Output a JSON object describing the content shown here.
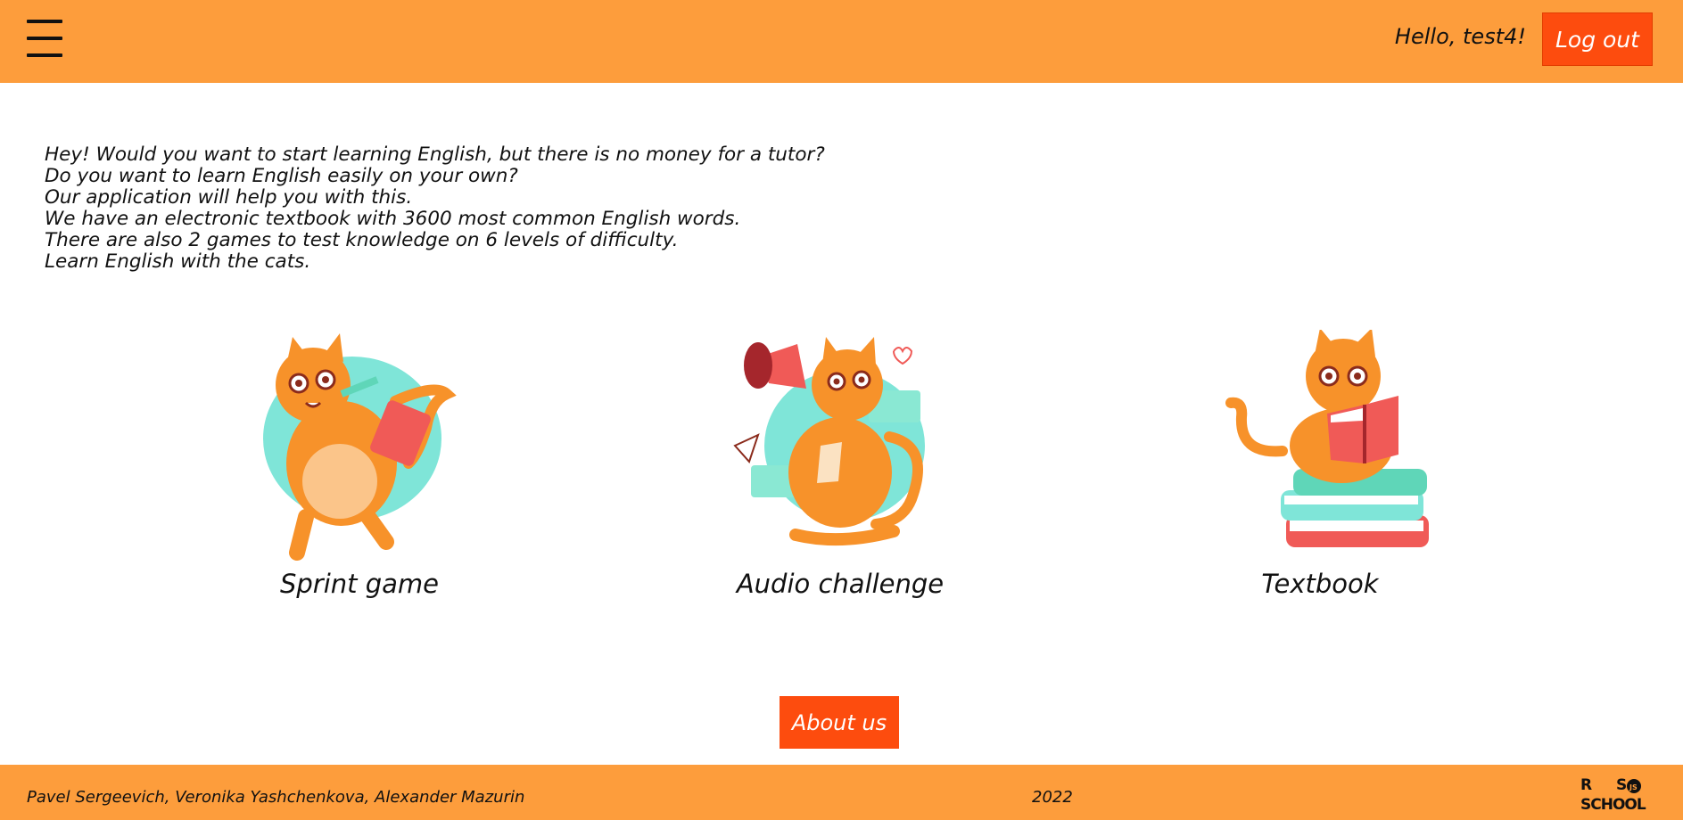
{
  "header": {
    "menu_icon": "hamburger-menu-icon",
    "greeting": "Hello, test4!",
    "logout_label": "Log out"
  },
  "intro": {
    "lines": [
      "Hey! Would you want to start learning English, but there is no money for a tutor?",
      "Do you want to learn English easily on your own?",
      "Our application will help you with this.",
      "We have an electronic textbook with 3600 most common English words.",
      "There are also 2 games to test knowledge on 6 levels of difficulty.",
      "Learn English with the cats."
    ]
  },
  "cards": [
    {
      "label": "Sprint game",
      "icon": "running-cat-icon"
    },
    {
      "label": "Audio challenge",
      "icon": "megaphone-cat-icon"
    },
    {
      "label": "Textbook",
      "icon": "reading-cat-icon"
    }
  ],
  "about_label": "About us",
  "footer": {
    "authors": "Pavel Sergeevich, Veronika Yashchenkova, Alexander Mazurin",
    "year": "2022",
    "logo_text": "RS SCHOOL"
  },
  "colors": {
    "header_bg": "#fd9d3c",
    "button_bg": "#fd4c0e",
    "cat_orange": "#f7922a",
    "accent_teal": "#7fe5d8",
    "accent_red": "#f05a57"
  }
}
